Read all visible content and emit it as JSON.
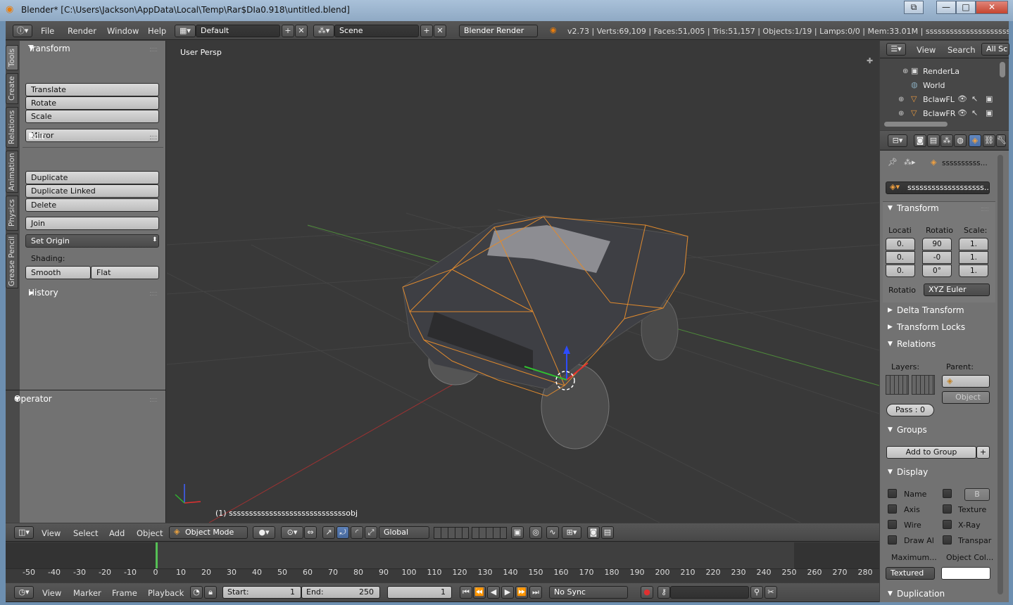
{
  "window": {
    "title": "Blender* [C:\\Users\\Jackson\\AppData\\Local\\Temp\\Rar$DIa0.918\\untitled.blend]",
    "min": "—",
    "max": "□",
    "close": "✕",
    "restore": "⧉"
  },
  "info_header": {
    "menus": [
      "File",
      "Render",
      "Window",
      "Help"
    ],
    "layout": "Default",
    "scene": "Scene",
    "engine": "Blender Render",
    "stats": "v2.73 | Verts:69,109 | Faces:51,005 | Tris:51,157 | Objects:1/19 | Lamps:0/0 | Mem:33.01M | sssssssssssssssssssssssssssssss"
  },
  "tool_tabs": [
    "Tools",
    "Create",
    "Relations",
    "Animation",
    "Physics",
    "Grease Pencil"
  ],
  "tools": {
    "transform_title": "Transform",
    "translate": "Translate",
    "rotate": "Rotate",
    "scale": "Scale",
    "mirror": "Mirror",
    "edit_title": "Edit",
    "duplicate": "Duplicate",
    "duplicate_linked": "Duplicate Linked",
    "delete": "Delete",
    "join": "Join",
    "set_origin": "Set Origin",
    "shading_label": "Shading:",
    "smooth": "Smooth",
    "flat": "Flat",
    "history_title": "History",
    "operator_title": "Operator"
  },
  "viewport": {
    "persp_label": "User Persp",
    "object_label": "(1) sssssssssssssssssssssssssssssobj"
  },
  "view3d_header": {
    "menus": [
      "View",
      "Select",
      "Add",
      "Object"
    ],
    "mode": "Object Mode",
    "orientation": "Global"
  },
  "timeline": {
    "ticks": [
      "-50",
      "-40",
      "-30",
      "-20",
      "-10",
      "0",
      "10",
      "20",
      "30",
      "40",
      "50",
      "60",
      "70",
      "80",
      "90",
      "100",
      "110",
      "120",
      "130",
      "140",
      "150",
      "160",
      "170",
      "180",
      "190",
      "200",
      "210",
      "220",
      "230",
      "240",
      "250",
      "260",
      "270",
      "280"
    ],
    "menus": [
      "View",
      "Marker",
      "Frame",
      "Playback"
    ],
    "start_label": "Start:",
    "start": "1",
    "end_label": "End:",
    "end": "250",
    "current": "1",
    "sync": "No Sync"
  },
  "outliner": {
    "menus": [
      "View",
      "Search"
    ],
    "filter": "All Sc",
    "rows": [
      "RenderLa",
      "World",
      "BclawFL",
      "BclawFR"
    ]
  },
  "properties": {
    "object_name_short": "ssssssssss...",
    "object_name": "sssssssssssssssssss...",
    "transform_title": "Transform",
    "loc_label": "Locati",
    "rot_label": "Rotatio",
    "scale_label": "Scale:",
    "loc": [
      "0.",
      "0.",
      "0."
    ],
    "rot": [
      "90",
      "-0",
      "0°"
    ],
    "scale": [
      "1.",
      "1.",
      "1."
    ],
    "rot_mode_label": "Rotatio",
    "rot_mode": "XYZ Euler",
    "delta_title": "Delta Transform",
    "locks_title": "Transform Locks",
    "relations_title": "Relations",
    "layers_label": "Layers:",
    "parent_label": "Parent:",
    "parent_type": "Object",
    "pass": "Pass : 0",
    "groups_title": "Groups",
    "add_group": "Add to Group",
    "display_title": "Display",
    "name": "Name",
    "axis": "Axis",
    "wire": "Wire",
    "drawall": "Draw Al",
    "texture": "Texture",
    "xray": "X-Ray",
    "transp": "Transpar",
    "bounds_val": "B",
    "max_label": "Maximum...",
    "objcol_label": "Object Col...",
    "draw_type": "Textured",
    "duplication_title": "Duplication"
  }
}
